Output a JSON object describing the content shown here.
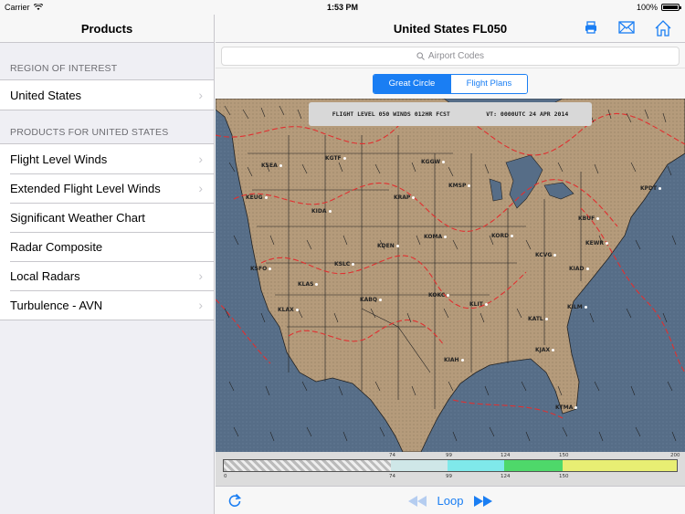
{
  "status": {
    "carrier": "Carrier",
    "time": "1:53 PM",
    "battery": "100%",
    "battery_level": 1.0
  },
  "sidebar": {
    "title": "Products",
    "region_header": "REGION OF INTEREST",
    "region_value": "United States",
    "products_header": "PRODUCTS FOR UNITED STATES",
    "products": [
      {
        "label": "Flight Level Winds",
        "chevron": true
      },
      {
        "label": "Extended Flight Level Winds",
        "chevron": true
      },
      {
        "label": "Significant Weather Chart",
        "chevron": false
      },
      {
        "label": "Radar Composite",
        "chevron": false
      },
      {
        "label": "Local Radars",
        "chevron": true
      },
      {
        "label": "Turbulence - AVN",
        "chevron": true
      }
    ]
  },
  "main": {
    "title": "United States FL050",
    "search_placeholder": "Airport Codes",
    "segments": {
      "active": "Great Circle",
      "inactive": "Flight Plans"
    },
    "icons": [
      "printer-icon",
      "mail-icon",
      "home-icon"
    ]
  },
  "map": {
    "header_left": "FLIGHT LEVEL 050 WINDS 012HR FCST",
    "header_right": "VT: 0000UTC 24 APR 2014",
    "airports": [
      "KSEA",
      "KGTF",
      "KGGW",
      "KEUG",
      "KMSP",
      "KRAP",
      "KBUF",
      "KPDT",
      "KIDA",
      "KOMA",
      "KORD",
      "KEWR",
      "KDEN",
      "KCVG",
      "KIAD",
      "KSFO",
      "KLAS",
      "KSLC",
      "KLAX",
      "KABQ",
      "KOKC",
      "KLIT",
      "KATL",
      "KILM",
      "KJAX",
      "KIAH",
      "KTMA"
    ],
    "legend": {
      "top_ticks": [
        "74",
        "99",
        "124",
        "150",
        "200"
      ],
      "bottom_ticks": [
        "0",
        "74",
        "99",
        "124",
        "150"
      ],
      "colors": [
        "#aaa",
        "#cfe7e8",
        "#7fe9ea",
        "#4ed86a",
        "#e8ee73"
      ]
    },
    "colors": {
      "land": "#b49a7a",
      "water": "#536b85",
      "isotach": "#e03030",
      "border": "#222222"
    }
  },
  "toolbar": {
    "loop_label": "Loop"
  }
}
